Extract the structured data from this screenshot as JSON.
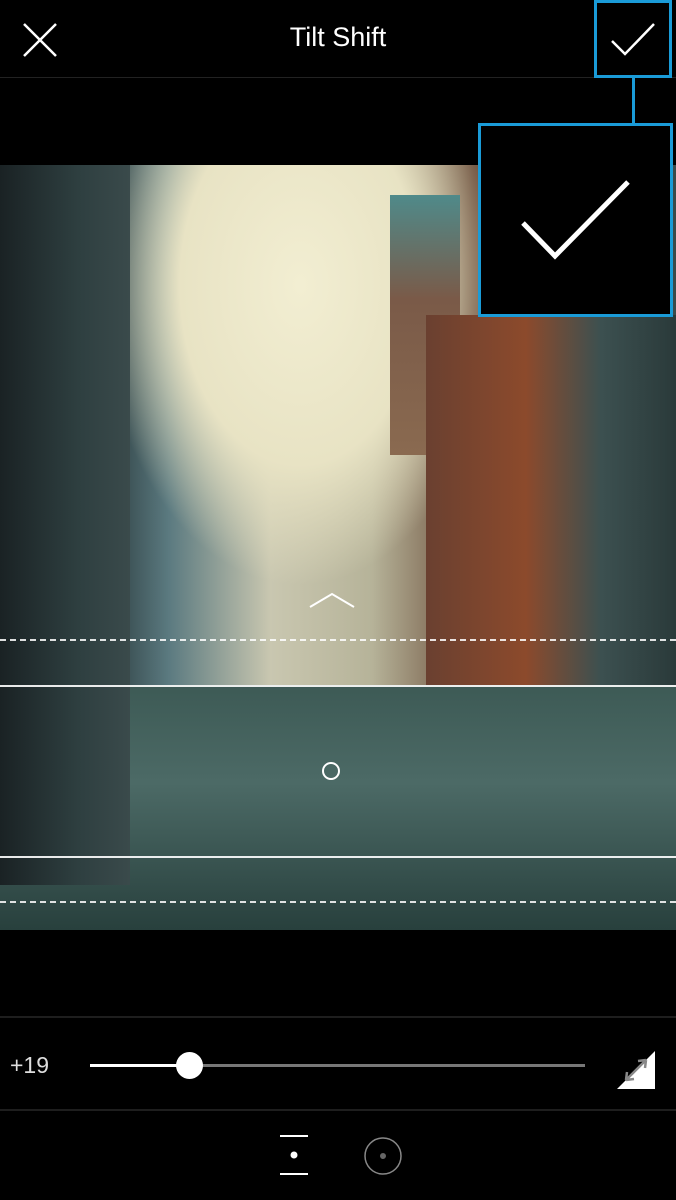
{
  "header": {
    "title": "Tilt Shift",
    "close_icon": "close-icon",
    "confirm_icon": "checkmark-icon",
    "highlight_color": "#1a9bd7"
  },
  "slider": {
    "label": "+19",
    "value": 19,
    "fraction": 0.2
  },
  "tools": {
    "swap_icon": "invert-blur-icon",
    "modes": [
      {
        "name": "linear-mode-icon",
        "selected": true
      },
      {
        "name": "radial-mode-icon",
        "selected": false
      }
    ]
  }
}
